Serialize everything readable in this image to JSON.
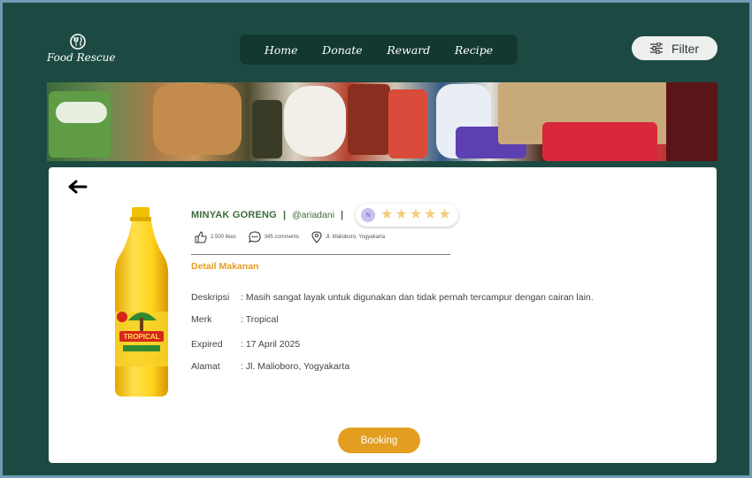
{
  "header": {
    "logo_text": "Food Rescue",
    "nav": [
      "Home",
      "Donate",
      "Reward",
      "Recipe"
    ],
    "filter_label": "Filter"
  },
  "product": {
    "name": "MINYAK GORENG",
    "separator": "|",
    "username": "@ariadani",
    "avatar_initial": "N",
    "rating": 5,
    "likes": "2.500 likes",
    "comments": "345 comments",
    "location": "Jl. Malioboro, Yogyakarta",
    "section_title": "Detail Makanan",
    "details": [
      {
        "key": "Deskripsi",
        "value": ": Masih sangat layak untuk digunakan dan tidak pernah   tercampur dengan cairan lain."
      },
      {
        "key": "Merk",
        "value": ": Tropical"
      },
      {
        "key": "Expired",
        "value": ": 17 April 2025"
      },
      {
        "key": "Alamat",
        "value": ": Jl. Malioboro, Yogyakarta"
      }
    ],
    "booking_label": "Booking",
    "brand_label": "TROPICAL"
  },
  "colors": {
    "background": "#1c4a42",
    "nav_bg": "#12382f",
    "accent": "#e39e22",
    "title_green": "#3d6b3b",
    "star": "#f4cd7c"
  }
}
